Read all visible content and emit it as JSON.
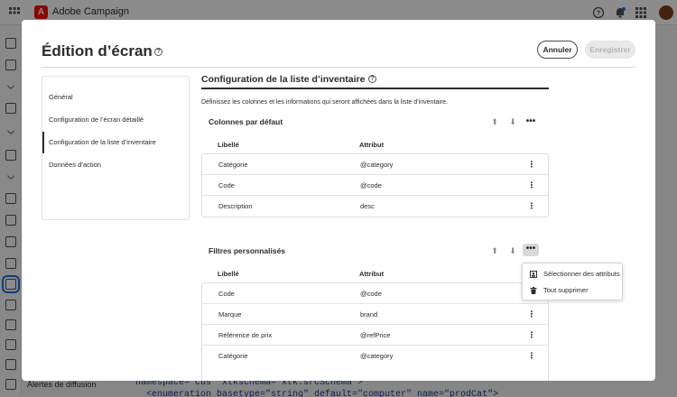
{
  "app": {
    "brand_name": "Adobe Campaign",
    "logo_letter": "A",
    "bottom_label": "Alertes de diffusion",
    "code_lines": [
      "namespace=\"cus\" xtkschema=\"xtk:srcSchema\">",
      "  <enumeration basetype=\"string\" default=\"computer\" name=\"prodCat\">"
    ],
    "icons": [
      "apps-icon",
      "help-circle-icon",
      "bell-icon",
      "apps-grid-icon",
      "avatar"
    ]
  },
  "modal": {
    "title": "Édition d’écran",
    "help_glyph": "?",
    "cancel_label": "Annuler",
    "save_label": "Enregistrer",
    "nav": [
      {
        "label": "Général",
        "active": false
      },
      {
        "label": "Configuration de l’écran détaillé",
        "active": false
      },
      {
        "label": "Configuration de la liste d’inventaire",
        "active": true
      },
      {
        "label": "Données d’action",
        "active": false
      }
    ],
    "section": {
      "title": "Configuration de la liste d’inventaire",
      "description": "Définissez les colonnes et les informations qui seront affichées dans la liste d’inventaire."
    },
    "default_columns": {
      "title": "Colonnes par défaut",
      "headers": {
        "label": "Libellé",
        "attribute": "Attribut"
      },
      "rows": [
        {
          "label": "Catégorie",
          "attribute": "@category"
        },
        {
          "label": "Code",
          "attribute": "@code"
        },
        {
          "label": "Description",
          "attribute": "desc"
        }
      ]
    },
    "custom_filters": {
      "title": "Filtres personnalisés",
      "headers": {
        "label": "Libellé",
        "attribute": "Attribut"
      },
      "rows": [
        {
          "label": "Code",
          "attribute": "@code"
        },
        {
          "label": "Marque",
          "attribute": "brand"
        },
        {
          "label": "Référence de prix",
          "attribute": "@refPrice"
        },
        {
          "label": "Catégorie",
          "attribute": "@category"
        }
      ]
    },
    "popover": {
      "items": [
        {
          "label": "Sélectionner des attributs",
          "icon": "select-attributes-icon"
        },
        {
          "label": "Tout supprimer",
          "icon": "trash-icon"
        }
      ]
    },
    "glyphs": {
      "up": "⬆",
      "down": "⬇",
      "more": "•••",
      "row_more": "⋮"
    }
  },
  "colors": {
    "accent": "#1473e6",
    "adobe_red": "#fa0f00",
    "disabled_bg": "#e9e9e9",
    "disabled_text": "#b3b3b3"
  }
}
